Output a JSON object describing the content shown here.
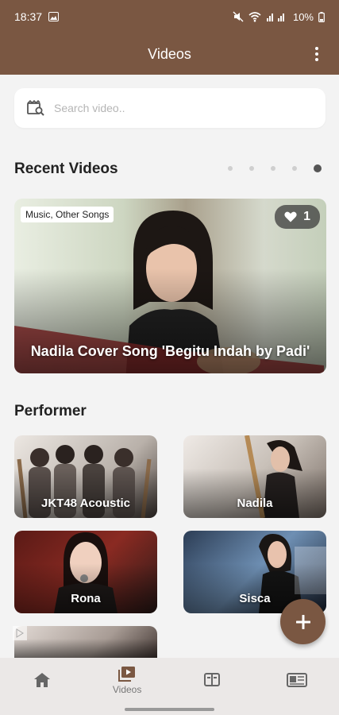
{
  "status_bar": {
    "time": "18:37",
    "battery": "10%"
  },
  "app_bar": {
    "title": "Videos"
  },
  "search": {
    "placeholder": "Search video.."
  },
  "recent": {
    "title": "Recent Videos",
    "pager": {
      "count": 5,
      "active": 5
    },
    "featured": {
      "tag": "Music, Other Songs",
      "likes": "1",
      "title": "Nadila Cover Song 'Begitu Indah by Padi'"
    }
  },
  "performer": {
    "title": "Performer",
    "items": [
      {
        "name": "JKT48 Acoustic"
      },
      {
        "name": "Nadila"
      },
      {
        "name": "Rona"
      },
      {
        "name": "Sisca"
      }
    ]
  },
  "fab": {
    "icon": "plus-icon"
  },
  "bottom_nav": {
    "items": [
      {
        "icon": "home-icon",
        "label": ""
      },
      {
        "icon": "video-icon",
        "label": "Videos"
      },
      {
        "icon": "book-icon",
        "label": ""
      },
      {
        "icon": "news-icon",
        "label": ""
      }
    ],
    "active": 1
  },
  "colors": {
    "primary": "#7a5742",
    "background": "#f3f3f3"
  }
}
